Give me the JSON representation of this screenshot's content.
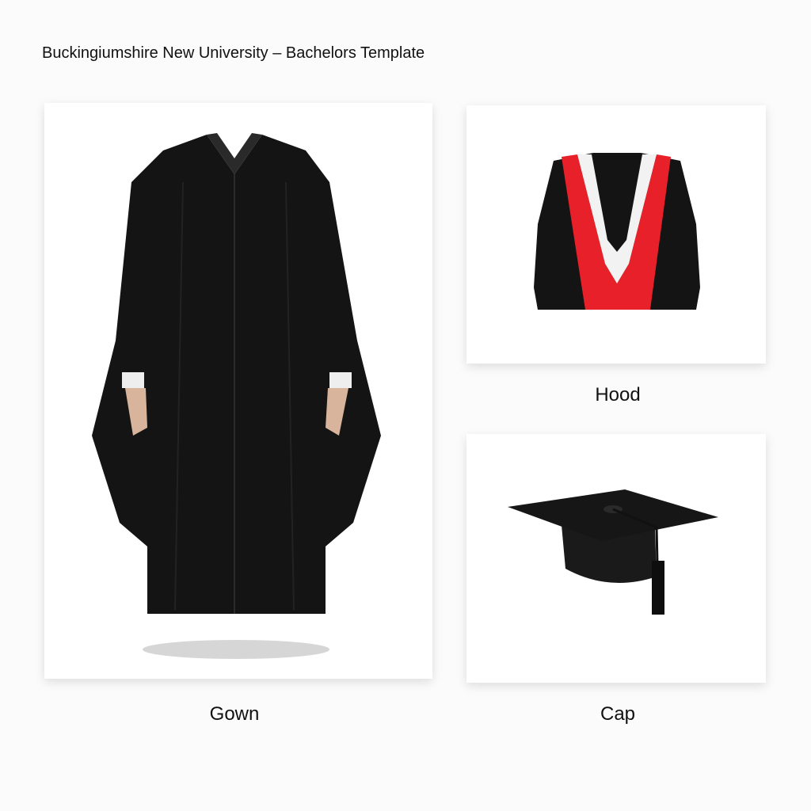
{
  "title": "Buckingiumshire New University – Bachelors Template",
  "items": [
    {
      "label": "Gown"
    },
    {
      "label": "Hood"
    },
    {
      "label": "Cap"
    }
  ],
  "colors": {
    "gown": "#111111",
    "hood_lining": "#e8202a",
    "hood_trim": "#f2f2f2",
    "background": "#fbfbfb"
  }
}
